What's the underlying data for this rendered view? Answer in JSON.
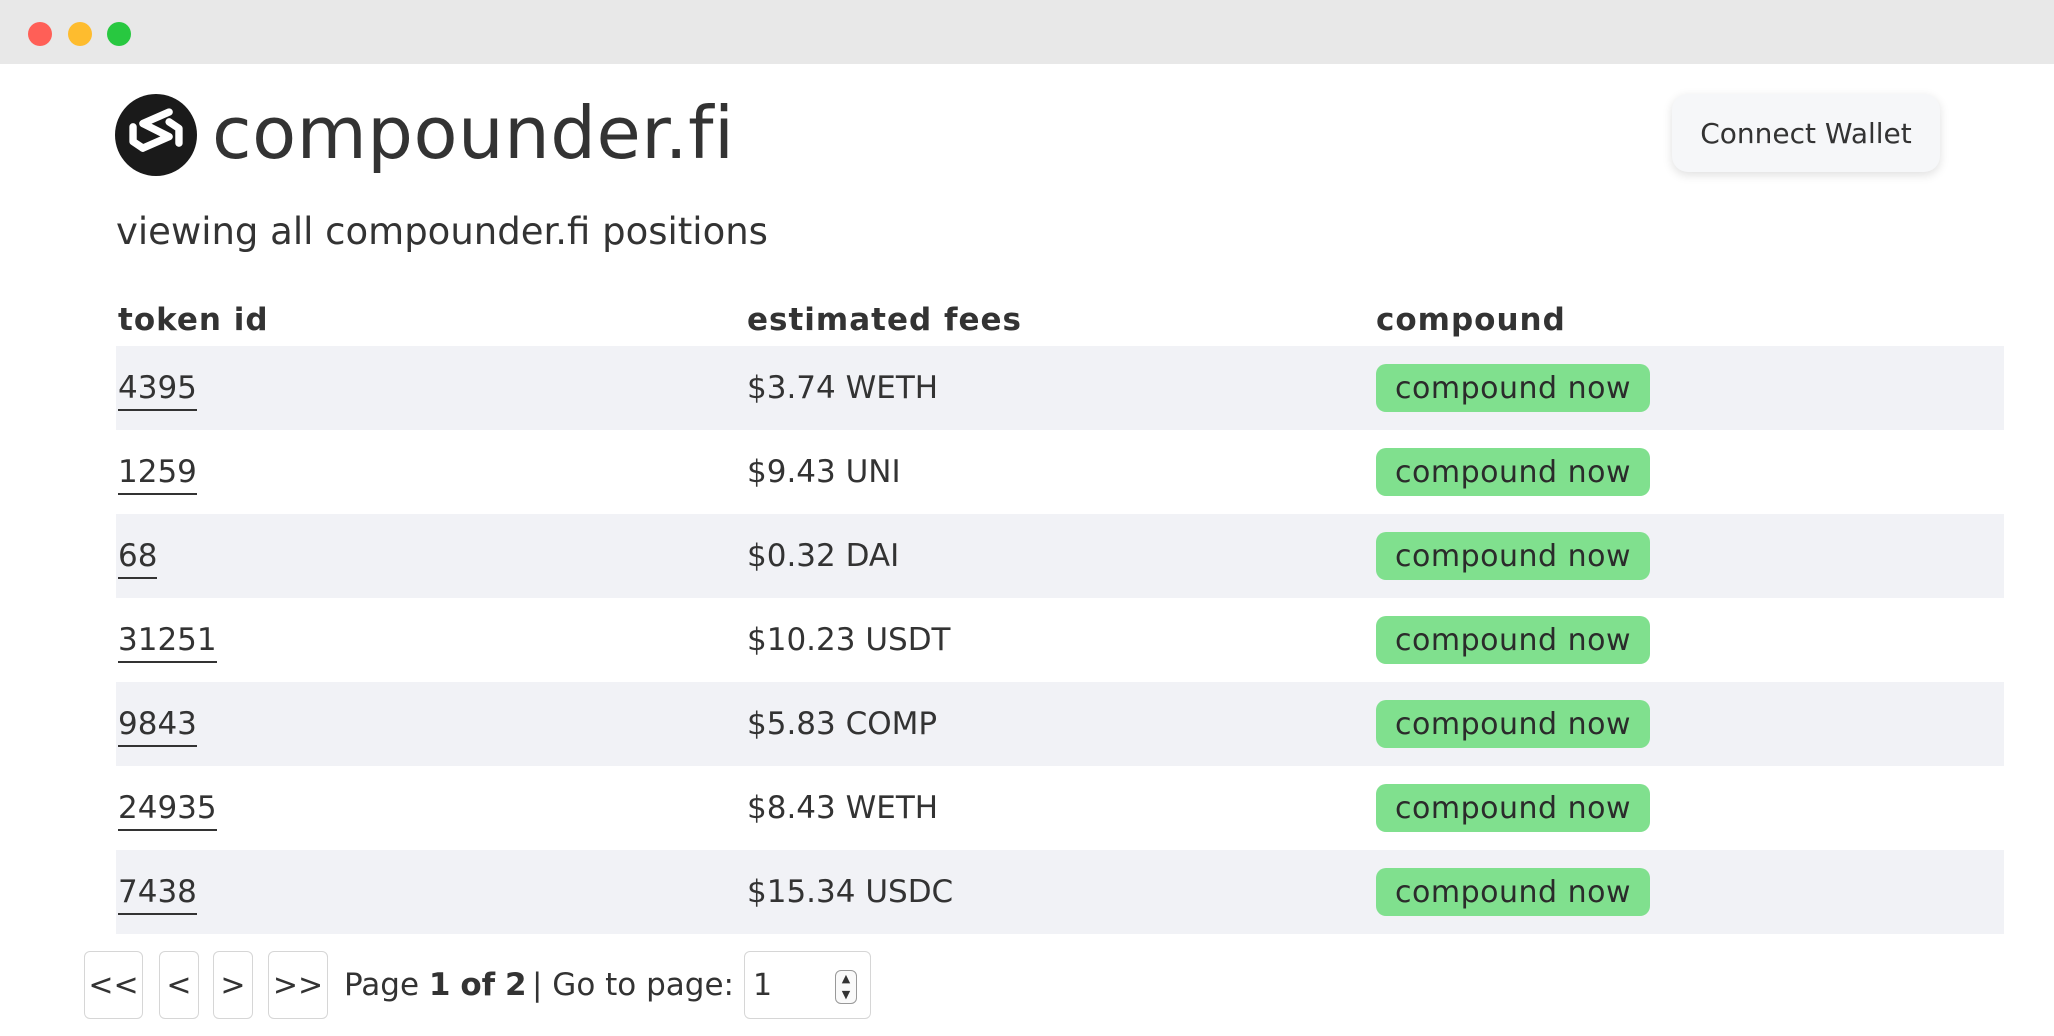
{
  "window": {
    "controls": [
      "close",
      "minimize",
      "maximize"
    ]
  },
  "header": {
    "logo_icon": "compounder-logo-icon",
    "brand": "compounder.fi",
    "connect_label": "Connect Wallet"
  },
  "subtitle": "viewing all compounder.fi positions",
  "table": {
    "headers": [
      "token id",
      "estimated fees",
      "compound"
    ],
    "rows": [
      {
        "token_id": "4395",
        "fees": "$3.74 WETH",
        "action": "compound now"
      },
      {
        "token_id": "1259",
        "fees": "$9.43 UNI",
        "action": "compound now"
      },
      {
        "token_id": "68",
        "fees": "$0.32 DAI",
        "action": "compound now"
      },
      {
        "token_id": "31251",
        "fees": "$10.23 USDT",
        "action": "compound now"
      },
      {
        "token_id": "9843",
        "fees": "$5.83 COMP",
        "action": "compound now"
      },
      {
        "token_id": "24935",
        "fees": "$8.43 WETH",
        "action": "compound now"
      },
      {
        "token_id": "7438",
        "fees": "$15.34 USDC",
        "action": "compound now"
      }
    ]
  },
  "pagination": {
    "first": "<<",
    "prev": "<",
    "next": ">",
    "last": ">>",
    "page_word": "Page",
    "current": "1",
    "of_word": "of",
    "total": "2",
    "goto_label": "| Go to page:",
    "goto_value": "1"
  },
  "colors": {
    "compound_button": "#80e08e",
    "row_stripe": "#f1f2f6",
    "text": "#333333"
  }
}
